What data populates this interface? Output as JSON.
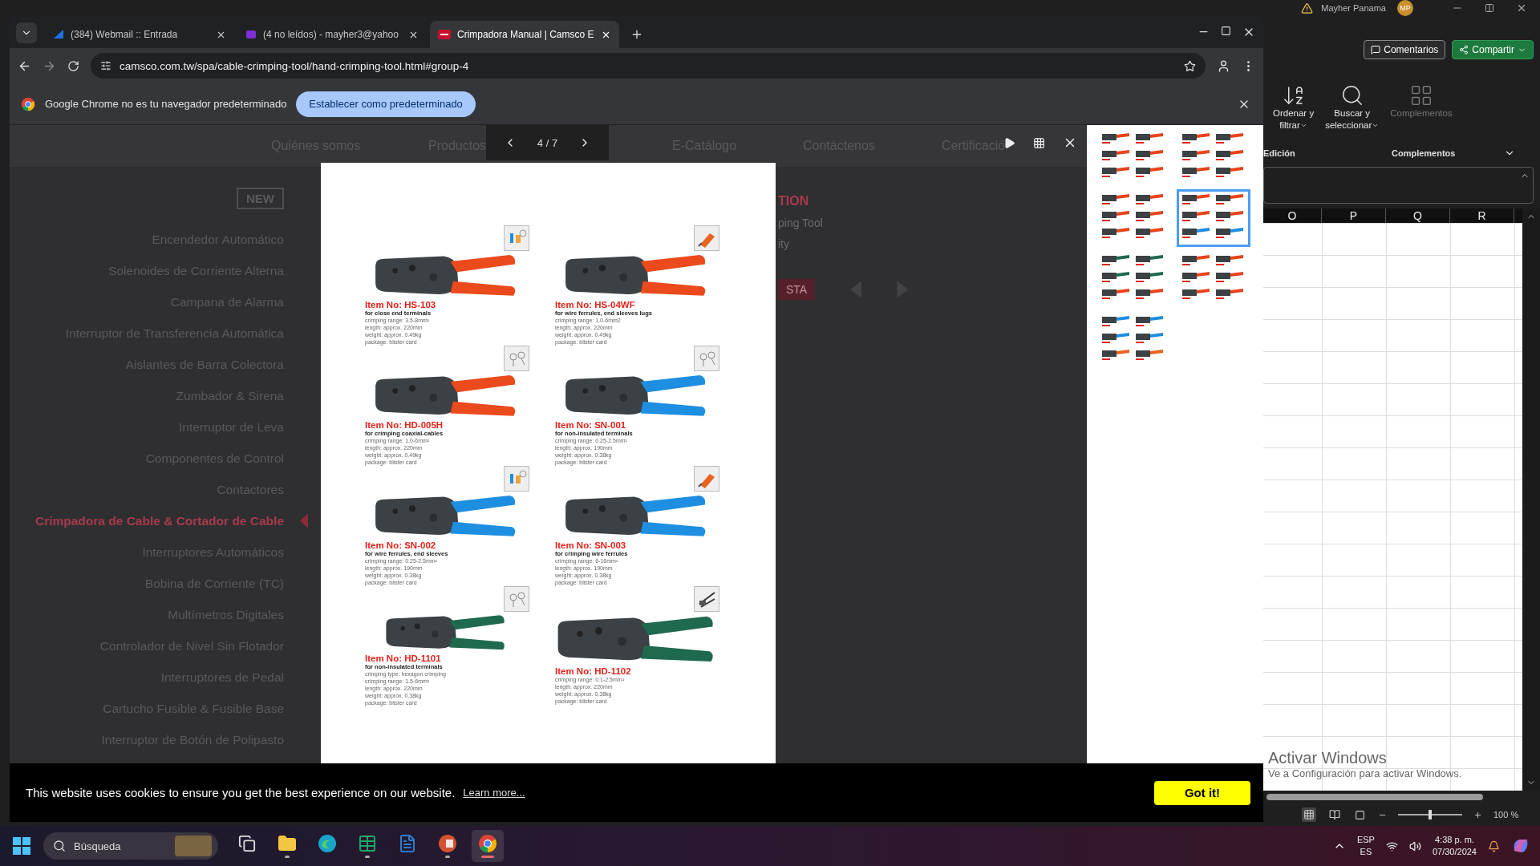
{
  "excel": {
    "account": {
      "name": "Mayher Panama",
      "initials": "MP"
    },
    "buttons": [
      {
        "kind": "outline",
        "label": "Comentarios"
      },
      {
        "kind": "primary",
        "label": "Compartir"
      }
    ],
    "ribbon_commands": [
      {
        "kind": "sort",
        "lines": [
          "Ordenar y",
          "filtrar"
        ],
        "dropdown": true,
        "disabled": false
      },
      {
        "kind": "find",
        "lines": [
          "Buscar y",
          "seleccionar"
        ],
        "dropdown": true,
        "disabled": false
      },
      {
        "kind": "addins",
        "lines": [
          "Complementos"
        ],
        "dropdown": false,
        "disabled": true
      }
    ],
    "ribbon_groups": [
      "Edición",
      "Complementos"
    ],
    "columns": [
      "O",
      "P",
      "Q",
      "R"
    ],
    "watermark": {
      "title": "Activar Windows",
      "subtitle": "Ve a Configuración para activar Windows."
    },
    "zoom": "100 %",
    "zoom_slider": {
      "level": 0.5
    }
  },
  "browser": {
    "tabs": [
      {
        "kind": "webmail",
        "title": "(384) Webmail :: Entrada",
        "selected": false
      },
      {
        "kind": "yahoo",
        "title": "(4 no leídos) - mayher3@yahoo",
        "selected": false
      },
      {
        "kind": "camsco",
        "title": "Crimpadora Manual | Camsco E",
        "selected": true
      }
    ],
    "address": "camsco.com.tw/spa/cable-crimping-tool/hand-crimping-tool.html#group-4",
    "infobar": {
      "message": "Google Chrome no es tu navegador predeterminado",
      "button": "Establecer como predeterminado"
    }
  },
  "page": {
    "nav": [
      "Quiénes somos",
      "Productos",
      "E-Catálogo",
      "Contáctenos",
      "Certificació"
    ],
    "sidebar": {
      "badge": "NEW",
      "items": [
        {
          "label": "Encendedor Automático",
          "selected": false
        },
        {
          "label": "Solenoides de Corriente Alterna",
          "selected": false
        },
        {
          "label": "Campana de Alarma",
          "selected": false
        },
        {
          "label": "Interruptor de Transferencia Automática",
          "selected": false
        },
        {
          "label": "Aislantes de Barra Colectora",
          "selected": false
        },
        {
          "label": "Zumbador & Sirena",
          "selected": false
        },
        {
          "label": "Interruptor de Leva",
          "selected": false
        },
        {
          "label": "Componentes de Control",
          "selected": false
        },
        {
          "label": "Contactores",
          "selected": false
        },
        {
          "label": "Crimpadora de Cable & Cortador de Cable",
          "selected": true
        },
        {
          "label": "Interruptores Automáticos",
          "selected": false
        },
        {
          "label": "Bobina de Corriente (TC)",
          "selected": false
        },
        {
          "label": "Multímetros Digitales",
          "selected": false
        },
        {
          "label": "Controlador de Nivel Sin Flotador",
          "selected": false
        },
        {
          "label": "Interruptores de Pedal",
          "selected": false
        },
        {
          "label": "Cartucho Fusible & Fusible Base",
          "selected": false
        },
        {
          "label": "Interruptor de Botón de Polipasto",
          "selected": false
        }
      ]
    },
    "fragments": {
      "heading": "TION",
      "lines": [
        "ping Tool",
        "ity"
      ],
      "button": "STA"
    }
  },
  "lightbox": {
    "counter": "4 / 7",
    "items": [
      {
        "item_no": "Item No: HS-103",
        "description": "for close end terminals",
        "specs": [
          "crimping range: 3.5-8mm²",
          "length: approx. 220mm",
          "weight: approx. 0.49kg",
          "package: blister card"
        ],
        "color": "#ea4a1c",
        "kind": "terminals"
      },
      {
        "item_no": "Item No: HS-04WF",
        "description": "for wire ferrules, end sleeves lugs",
        "specs": [
          "crimping range: 1.0-6mm2",
          "length: approx. 220mm",
          "weight: approx. 0.49kg",
          "package: blister card"
        ],
        "color": "#ea4a1c",
        "kind": "ferrule"
      },
      {
        "item_no": "Item No: HD-005H",
        "description": "for crimping coaxial-cables",
        "specs": [
          "crimping range: 1.0-6mm²",
          "length: approx. 220mm",
          "weight: approx. 0.49kg",
          "package: blister card"
        ],
        "color": "#ea4a1c",
        "kind": "rings"
      },
      {
        "item_no": "Item No: SN-001",
        "description": "for non-insulated terminals",
        "specs": [
          "crimping range: 0.25-2.5mm²",
          "length: approx. 190mm",
          "weight: approx. 0.38kg",
          "package: blister card"
        ],
        "color": "#1e8ee0",
        "kind": "rings"
      },
      {
        "item_no": "Item No: SN-002",
        "description": "for wire ferrules, end sleeves",
        "specs": [
          "crimping range: 0.25-2.5mm²",
          "length: approx. 190mm",
          "weight: approx. 0.38kg",
          "package: blister card"
        ],
        "color": "#1e8ee0",
        "kind": "terminals"
      },
      {
        "item_no": "Item No: SN-003",
        "description": "for crimping wire ferrules",
        "specs": [
          "crimping range: 6-16mm²",
          "length: approx. 190mm",
          "weight: approx. 0.38kg",
          "package: blister card"
        ],
        "color": "#1e8ee0",
        "kind": "ferrule"
      },
      {
        "item_no": "Item No: HD-1101",
        "description": "for non-insulated terminals",
        "specs": [
          "crimping type: hexagon crimping",
          "crimping range: 1.5-6mm²",
          "length: approx. 220mm",
          "weight: approx. 0.38kg",
          "package: blister card"
        ],
        "color": "#1f6a4e",
        "kind": "rings"
      },
      {
        "item_no": "Item No: HD-1102",
        "specs": [
          "crimping range: 0.1-2.5mm²",
          "length: approx. 220mm",
          "weight: approx. 0.38kg",
          "package: blister card"
        ],
        "color": "#1f6a4e",
        "kind": "connector"
      }
    ],
    "thumbnails": [
      {
        "selected": false
      },
      {
        "selected": false
      },
      {
        "selected": false
      },
      {
        "selected": true
      },
      {
        "selected": false
      },
      {
        "selected": false
      },
      {
        "selected": false
      }
    ]
  },
  "cookie_bar": {
    "message": "This website uses cookies to ensure you get the best experience on our website.",
    "link": "Learn more...",
    "button": "Got it!"
  },
  "taskbar": {
    "search_placeholder": "Búsqueda",
    "apps": [
      {
        "kind": "taskview",
        "running": false,
        "selected": false
      },
      {
        "kind": "explorer",
        "running": true,
        "selected": false
      },
      {
        "kind": "edge",
        "running": false,
        "selected": false
      },
      {
        "kind": "excel",
        "running": true,
        "selected": false
      },
      {
        "kind": "word",
        "running": false,
        "selected": false
      },
      {
        "kind": "powerpoint",
        "running": true,
        "selected": false
      },
      {
        "kind": "chrome",
        "running": true,
        "selected": true
      }
    ],
    "language": [
      "ESP",
      "ES"
    ],
    "time": "4:38 p. m.",
    "date": "07/30/2024"
  }
}
